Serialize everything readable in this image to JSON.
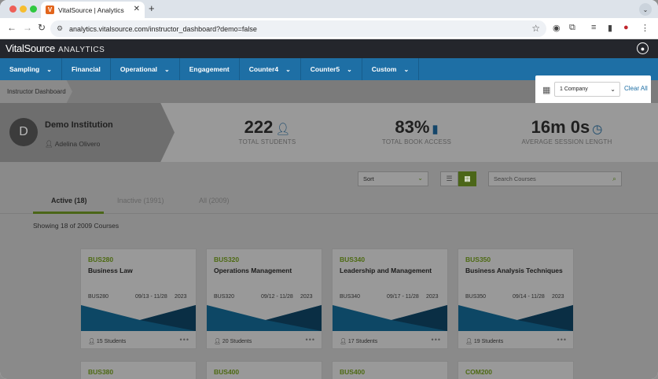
{
  "browser": {
    "tab_title": "VitalSource | Analytics",
    "tab_favicon_letter": "V",
    "url": "analytics.vitalsource.com/instructor_dashboard?demo=false"
  },
  "app": {
    "logo_main": "VitalSource",
    "logo_sub": "ANALYTICS",
    "nav": [
      {
        "label": "Sampling",
        "dropdown": true
      },
      {
        "label": "Financial",
        "dropdown": false
      },
      {
        "label": "Operational",
        "dropdown": true
      },
      {
        "label": "Engagement",
        "dropdown": false
      },
      {
        "label": "Counter4",
        "dropdown": true
      },
      {
        "label": "Counter5",
        "dropdown": true
      },
      {
        "label": "Custom",
        "dropdown": true
      }
    ]
  },
  "breadcrumb": "Instructor Dashboard",
  "filter": {
    "company_value": "1 Company",
    "clear_label": "Clear All"
  },
  "institution": {
    "avatar_letter": "D",
    "name": "Demo Institution",
    "user": "Adelina Olivero"
  },
  "stats": [
    {
      "value": "222",
      "label": "TOTAL STUDENTS",
      "icon": "person-icon"
    },
    {
      "value": "83%",
      "label": "TOTAL BOOK ACCESS",
      "icon": "book-icon"
    },
    {
      "value": "16m 0s",
      "label": "AVERAGE SESSION LENGTH",
      "icon": "timer-icon"
    }
  ],
  "controls": {
    "sort_value": "Sort",
    "search_placeholder": "Search Courses"
  },
  "tabs": [
    {
      "label": "Active (18)"
    },
    {
      "label": "Inactive (1991)"
    },
    {
      "label": "All (2009)"
    }
  ],
  "showing": "Showing 18 of 2009 Courses",
  "courses": [
    {
      "code": "BUS280",
      "title": "Business Law",
      "dates": "09/13 - 11/28",
      "year": "2023",
      "students": "15 Students"
    },
    {
      "code": "BUS320",
      "title": "Operations Management",
      "dates": "09/12 - 11/28",
      "year": "2023",
      "students": "20 Students"
    },
    {
      "code": "BUS340",
      "title": "Leadership and Management",
      "dates": "09/17 - 11/28",
      "year": "2023",
      "students": "17 Students"
    },
    {
      "code": "BUS350",
      "title": "Business Analysis Techniques",
      "dates": "09/14 - 11/28",
      "year": "2023",
      "students": "19 Students"
    }
  ],
  "courses_row2": [
    {
      "code": "BUS380"
    },
    {
      "code": "BUS400"
    },
    {
      "code": "BUS400"
    },
    {
      "code": "COM200"
    }
  ],
  "colors": {
    "nav_blue": "#1e6fa5",
    "accent_green": "#4b6618",
    "header_dark": "#24262c"
  }
}
